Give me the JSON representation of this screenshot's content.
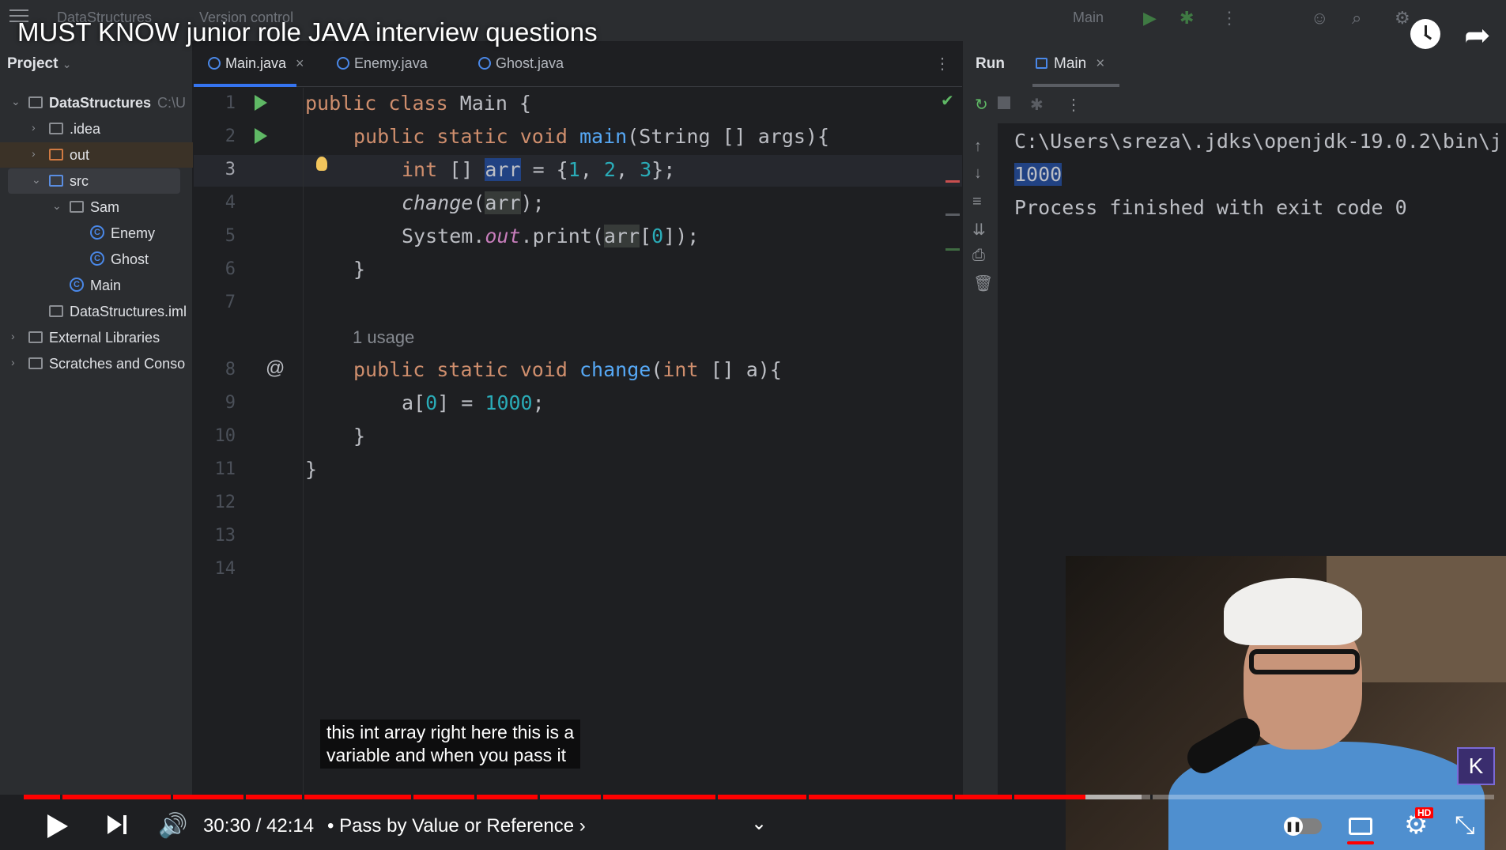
{
  "ide": {
    "project_name": "DataStructures",
    "vcs_label": "Version control",
    "run_config": "Main"
  },
  "video": {
    "title": "MUST KNOW junior role JAVA interview questions",
    "caption_line1": "this int array right here this is a",
    "caption_line2": "variable and when you pass it",
    "time": "30:30 / 42:14",
    "chapter": "• Pass by Value or Reference ›",
    "progress_fraction": 0.722,
    "buffer_fraction": 0.76,
    "hd_badge": "HD"
  },
  "project_panel": {
    "header": "Project",
    "tree": [
      {
        "label": "DataStructures",
        "path": "C:\\U",
        "type": "module",
        "expanded": true,
        "depth": 0
      },
      {
        "label": ".idea",
        "type": "folder",
        "expanded": false,
        "depth": 1
      },
      {
        "label": "out",
        "type": "folder-excluded",
        "expanded": false,
        "depth": 1
      },
      {
        "label": "src",
        "type": "folder-source",
        "expanded": true,
        "depth": 1
      },
      {
        "label": "Sam",
        "type": "package",
        "expanded": true,
        "depth": 2
      },
      {
        "label": "Enemy",
        "type": "class",
        "depth": 3
      },
      {
        "label": "Ghost",
        "type": "class",
        "depth": 3
      },
      {
        "label": "Main",
        "type": "class",
        "depth": 2
      },
      {
        "label": "DataStructures.iml",
        "type": "iml",
        "depth": 1
      },
      {
        "label": "External Libraries",
        "type": "libraries",
        "expanded": false,
        "depth": 0
      },
      {
        "label": "Scratches and Conso",
        "type": "scratches",
        "expanded": false,
        "depth": 0
      }
    ]
  },
  "editor": {
    "tabs": [
      {
        "label": "Main.java",
        "active": true
      },
      {
        "label": "Enemy.java",
        "active": false
      },
      {
        "label": "Ghost.java",
        "active": false
      }
    ],
    "line_numbers": [
      "1",
      "2",
      "3",
      "4",
      "5",
      "6",
      "7",
      "8",
      "9",
      "10",
      "11",
      "12",
      "13",
      "14"
    ],
    "usage_hint": "1 usage",
    "lines": {
      "l1_kw": "public class",
      "l1_rest": " Main {",
      "l2_kw": "public static void",
      "l2_fn": "main",
      "l2_rest": "(String [] args){",
      "l3_kw": "int",
      "l3_a": " [] ",
      "l3_var": "arr",
      "l3_b": " = {",
      "l3_n1": "1",
      "l3_c1": ", ",
      "l3_n2": "2",
      "l3_c2": ", ",
      "l3_n3": "3",
      "l3_end": "};",
      "l4_fn": "change",
      "l4_open": "(",
      "l4_var": "arr",
      "l4_end": ");",
      "l5_a": "System.",
      "l5_fld": "out",
      "l5_b": ".print(",
      "l5_var": "arr",
      "l5_c": "[",
      "l5_n": "0",
      "l5_end": "]);",
      "l6": "}",
      "l8_kw": "public static void",
      "l8_fn": "change",
      "l8_open": "(",
      "l8_kw2": "int",
      "l8_rest": " [] a){",
      "l9_a": "a[",
      "l9_n": "0",
      "l9_b": "] = ",
      "l9_val": "1000",
      "l9_end": ";",
      "l10": "}",
      "l11": "}"
    }
  },
  "run_panel": {
    "label": "Run",
    "tab": "Main",
    "console": [
      "C:\\Users\\sreza\\.jdks\\openjdk-19.0.2\\bin\\j",
      "1000",
      "Process finished with exit code 0"
    ]
  },
  "colors": {
    "accent": "#3574f0",
    "progress_red": "#ff0000",
    "run_green": "#5fb865"
  }
}
